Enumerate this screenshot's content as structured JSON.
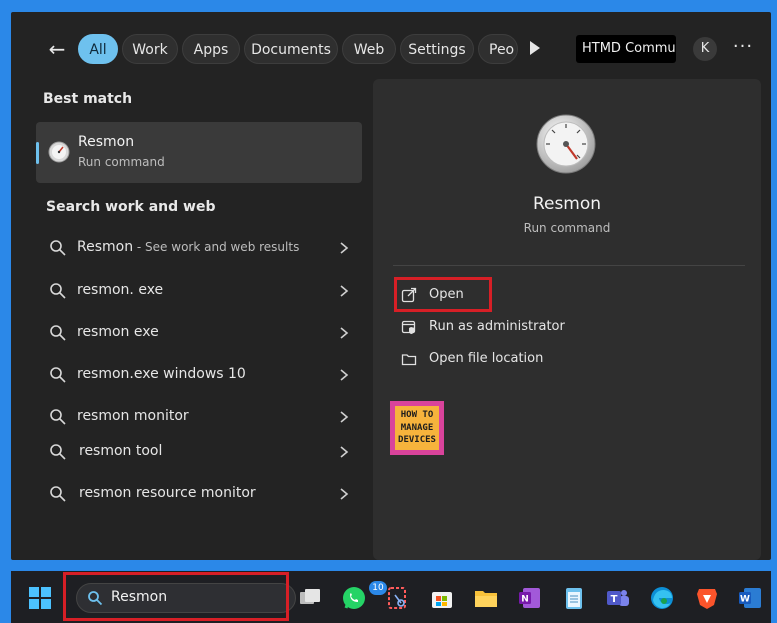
{
  "filters": {
    "back_label": "←",
    "chips": [
      "All",
      "Work",
      "Apps",
      "Documents",
      "Web",
      "Settings",
      "Peo"
    ],
    "org_label": "HTMD Commu...",
    "avatar_initial": "K",
    "more_label": "···"
  },
  "best_match": {
    "heading": "Best match",
    "title": "Resmon",
    "subtitle": "Run command"
  },
  "search_web": {
    "heading": "Search work and web",
    "items": [
      {
        "main": "Resmon",
        "suffix": " - See work and web results"
      },
      {
        "main": "resmon. exe",
        "suffix": ""
      },
      {
        "main": "resmon exe",
        "suffix": ""
      },
      {
        "main": "resmon.exe windows 10",
        "suffix": ""
      },
      {
        "main": "resmon monitor",
        "suffix": ""
      },
      {
        "main": "resmon tool",
        "suffix": ""
      },
      {
        "main": "resmon resource monitor",
        "suffix": ""
      }
    ]
  },
  "details": {
    "title": "Resmon",
    "subtitle": "Run command",
    "actions": [
      {
        "label": "Open",
        "icon": "open-external-icon"
      },
      {
        "label": "Run as administrator",
        "icon": "shield-admin-icon"
      },
      {
        "label": "Open file location",
        "icon": "folder-icon"
      }
    ],
    "logo_lines": [
      "HOW TO",
      "MANAGE",
      "DEVICES"
    ]
  },
  "taskbar": {
    "search_value": "Resmon",
    "whatsapp_badge": "10",
    "apps": [
      "task-view",
      "whatsapp",
      "snipping-tool",
      "store",
      "file-explorer",
      "onenote",
      "notepad",
      "teams",
      "edge",
      "brave",
      "word"
    ]
  },
  "colors": {
    "accent": "#6ec1ee",
    "highlight": "#d71f26",
    "desktop": "#2b88e8"
  }
}
